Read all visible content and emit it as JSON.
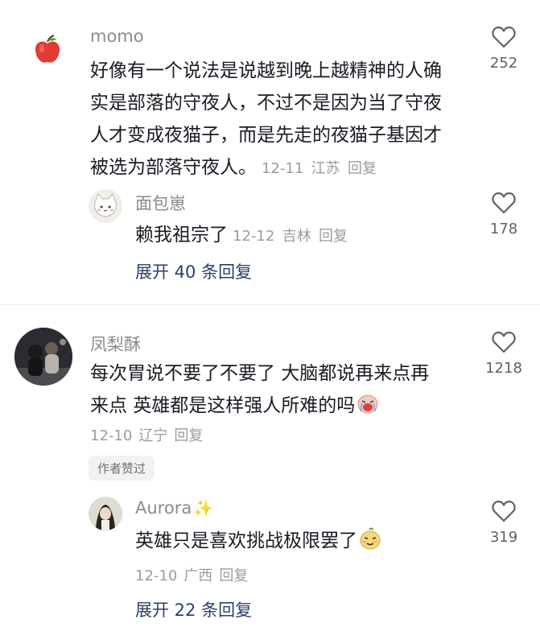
{
  "comments": [
    {
      "user": "momo",
      "avatar_icon": "apple-icon",
      "text": "好像有一个说法是说越到晚上越精神的人确实是部落的守夜人，不过不是因为当了守夜人才变成夜猫子，而是先走的夜猫子基因才被选为部落守夜人。",
      "lines": [
        "好像有一个说法是说越到晚上越精神的人确",
        "实是部落的守夜人，不过不是因为当了守夜",
        "人才变成夜猫子，而是先走的夜猫子基因才",
        "被选为部落守夜人。"
      ],
      "date": "12-11",
      "location": "江苏",
      "reply_label": "回复",
      "likes": "252",
      "replies": [
        {
          "user": "面包崽",
          "text": "赖我祖宗了",
          "date": "12-12",
          "location": "吉林",
          "reply_label": "回复",
          "likes": "178"
        }
      ],
      "expand_label": "展开 40 条回复"
    },
    {
      "user": "凤梨酥",
      "lines": [
        "每次胃说不要了不要了 大脑都说再来点再",
        "来点 英雄都是这样强人所难的吗"
      ],
      "text_emoji": "crying-face-emoji",
      "date": "12-10",
      "location": "辽宁",
      "reply_label": "回复",
      "likes": "1218",
      "author_badge": "作者赞过",
      "replies": [
        {
          "user": "Aurora",
          "user_emoji": "sparkles-icon",
          "text": "英雄只是喜欢挑战极限罢了",
          "text_emoji": "smug-face-emoji",
          "date": "12-10",
          "location": "广西",
          "reply_label": "回复",
          "likes": "319"
        }
      ],
      "expand_label": "展开 22 条回复"
    }
  ],
  "colors": {
    "name": "#8a8b91",
    "meta": "#9a9ba1",
    "expand": "#2b3f6b",
    "heart": "#5f6068"
  }
}
